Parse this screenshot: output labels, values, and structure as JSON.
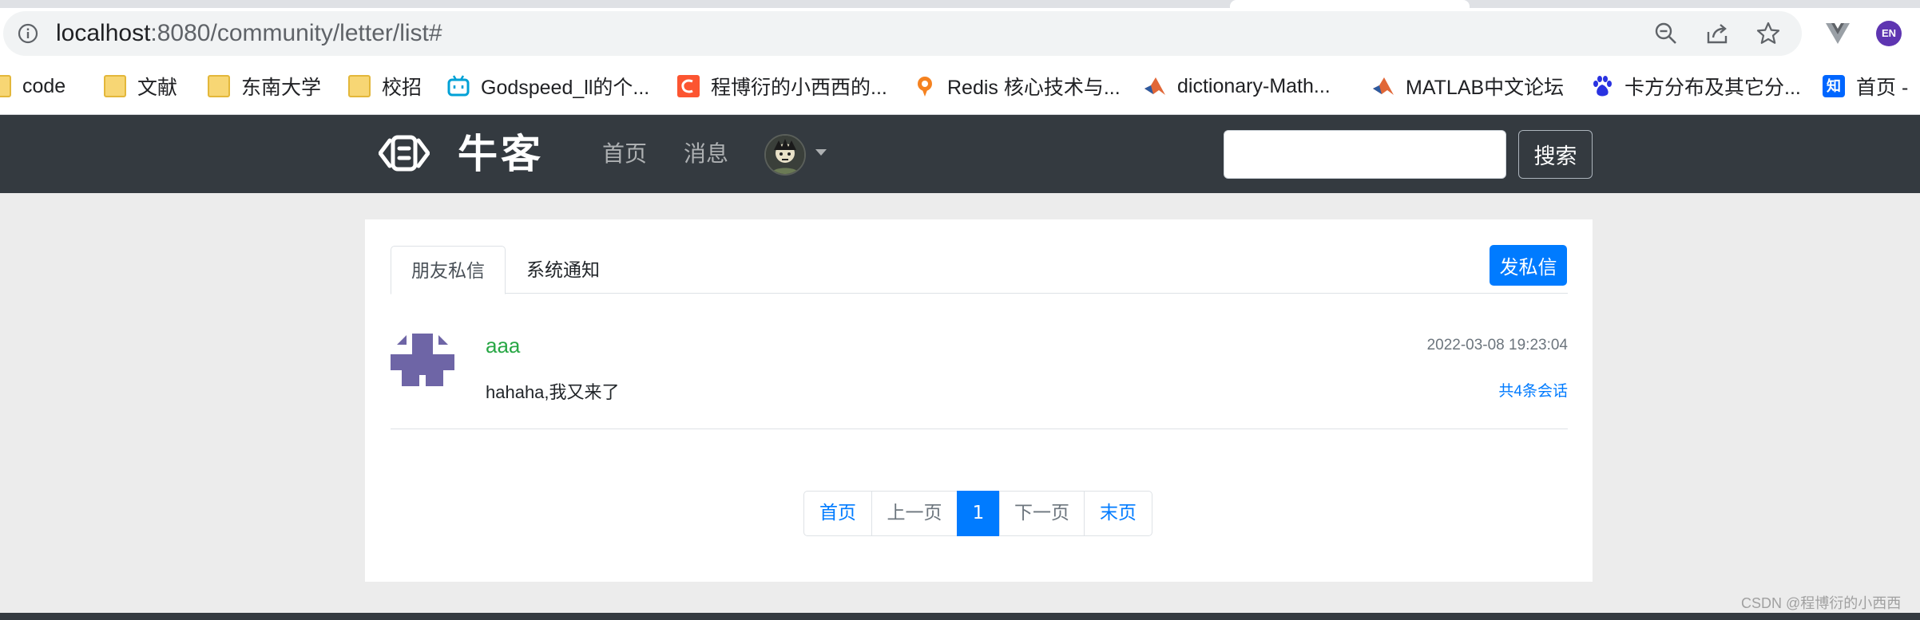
{
  "browser": {
    "url_host": "localhost",
    "url_rest": ":8080/community/letter/list#",
    "profile_initials": "EN",
    "bookmarks": [
      {
        "label": "code",
        "icon": "folder-icon"
      },
      {
        "label": "文献",
        "icon": "folder-icon"
      },
      {
        "label": "东南大学",
        "icon": "folder-icon"
      },
      {
        "label": "校招",
        "icon": "folder-icon"
      },
      {
        "label": "Godspeed_ll的个...",
        "icon": "bilibili-icon"
      },
      {
        "label": "程博衍的小西西的...",
        "icon": "csdn-icon"
      },
      {
        "label": "Redis 核心技术与...",
        "icon": "geektime-icon"
      },
      {
        "label": "dictionary-Math...",
        "icon": "matlab-icon"
      },
      {
        "label": "MATLAB中文论坛",
        "icon": "matlab-icon"
      },
      {
        "label": "卡方分布及其它分...",
        "icon": "baidu-icon"
      },
      {
        "label": "首页 -",
        "icon": "zhihu-icon"
      }
    ],
    "zhihu_glyph": "知"
  },
  "site": {
    "logo_text": "牛客",
    "nav": {
      "home": "首页",
      "messages": "消息"
    },
    "search": {
      "placeholder": "",
      "button": "搜索"
    }
  },
  "letters": {
    "tabs": [
      {
        "label": "朋友私信",
        "active": true
      },
      {
        "label": "系统通知",
        "active": false
      }
    ],
    "send_button": "发私信",
    "items": [
      {
        "username": "aaa",
        "time": "2022-03-08 19:23:04",
        "content": "hahaha,我又来了",
        "count_label": "共4条会话"
      }
    ],
    "pagination": {
      "first": "首页",
      "prev": "上一页",
      "current": "1",
      "next": "下一页",
      "last": "末页"
    }
  },
  "watermark": "CSDN @程博衍的小西西",
  "colors": {
    "navbar": "#343a40",
    "primary": "#007bff",
    "username": "#28a745",
    "avatar": "#6e65a6"
  }
}
